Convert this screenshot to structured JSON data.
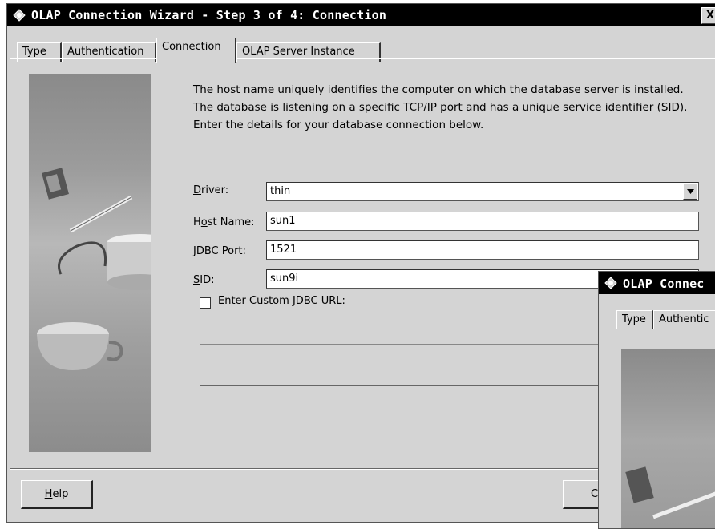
{
  "window": {
    "title": "OLAP Connection Wizard - Step 3 of 4: Connection",
    "close_label": "X"
  },
  "tabs": [
    "Type",
    "Authentication",
    "Connection",
    "OLAP Server Instance"
  ],
  "active_tab": "Connection",
  "description": "The host name uniquely identifies the computer on which the database server is installed.  The database is listening on a specific TCP/IP port and has a unique service identifier (SID).  Enter the details for your database connection below.",
  "form": {
    "driver": {
      "label_ul": "D",
      "label_rest": "river:",
      "value": "thin"
    },
    "host": {
      "label_pre": "H",
      "label_ul": "o",
      "label_rest": "st Name:",
      "value": "sun1"
    },
    "port": {
      "label_ul": "J",
      "label_rest": "DBC Port:",
      "value": "1521"
    },
    "sid": {
      "label_ul": "S",
      "label_rest": "ID:",
      "value": "sun9i"
    },
    "custom_url": {
      "label_pre": "Enter ",
      "label_ul": "C",
      "label_rest": "ustom JDBC URL:",
      "checked": false,
      "value": ""
    }
  },
  "buttons": {
    "help_ul": "H",
    "help_rest": "elp",
    "next_partial": "C"
  },
  "window2": {
    "title": "OLAP Connec",
    "tabs": [
      "Type",
      "Authentic"
    ]
  }
}
